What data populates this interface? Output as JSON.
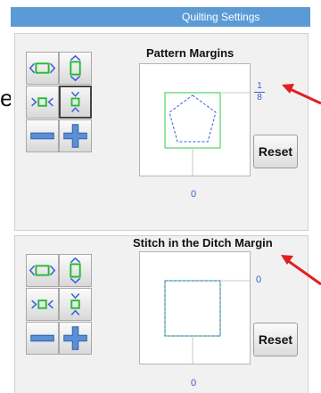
{
  "window": {
    "title": "Quilting Settings"
  },
  "stray_char": "e",
  "pattern_margins": {
    "title": "Pattern Margins",
    "side_value_num": "1",
    "side_value_den": "8",
    "bottom_value": "0",
    "reset_label": "Reset"
  },
  "stitch_margin": {
    "title": "Stitch in the Ditch Margin",
    "side_value": "0",
    "bottom_value": "0",
    "reset_label": "Reset"
  },
  "colors": {
    "title_bar": "#5b9bd5",
    "value_text": "#3b5bdb",
    "shape_green": "#2ecc40",
    "annotation_arrow": "#e02020"
  },
  "icons": [
    "expand-horizontal-icon",
    "expand-vertical-icon",
    "shrink-horizontal-icon",
    "shrink-vertical-icon",
    "minus-icon",
    "plus-icon"
  ]
}
